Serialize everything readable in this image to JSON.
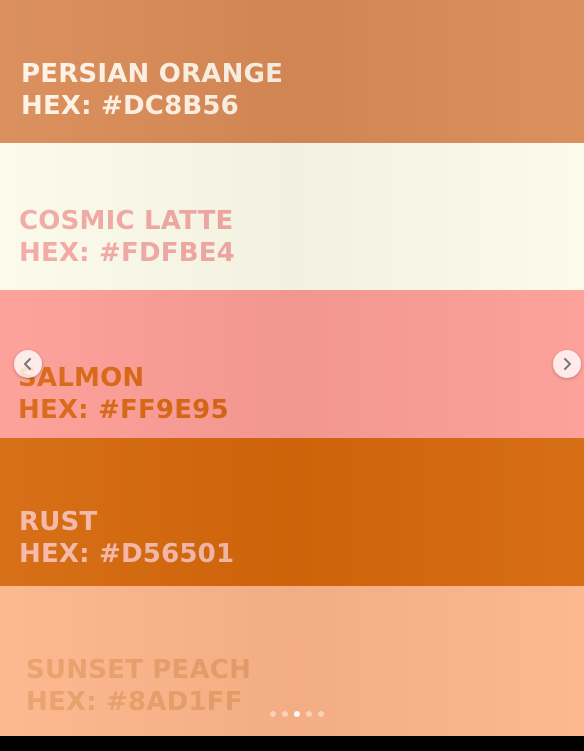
{
  "colors": {
    "persian_orange": "#DC8B56",
    "cosmic_latte": "#FDFBE4",
    "salmon": "#FF9E95",
    "rust": "#D56501",
    "sunset_peach": "#FFB38A"
  },
  "swatches": [
    {
      "name": "PERSIAN ORANGE",
      "hex": "HEX: #DC8B56"
    },
    {
      "name": "COSMIC LATTE",
      "hex": "HEX: #FDFBE4"
    },
    {
      "name": "SALMON",
      "hex": "HEX: #FF9E95"
    },
    {
      "name": "RUST",
      "hex": "HEX: #D56501"
    },
    {
      "name": "SUNSET PEACH",
      "hex": "HEX: #8AD1FF"
    }
  ],
  "carousel": {
    "prev_icon": "chevron-left-icon",
    "next_icon": "chevron-right-icon",
    "dot_count": 5,
    "active_dot": 3
  }
}
